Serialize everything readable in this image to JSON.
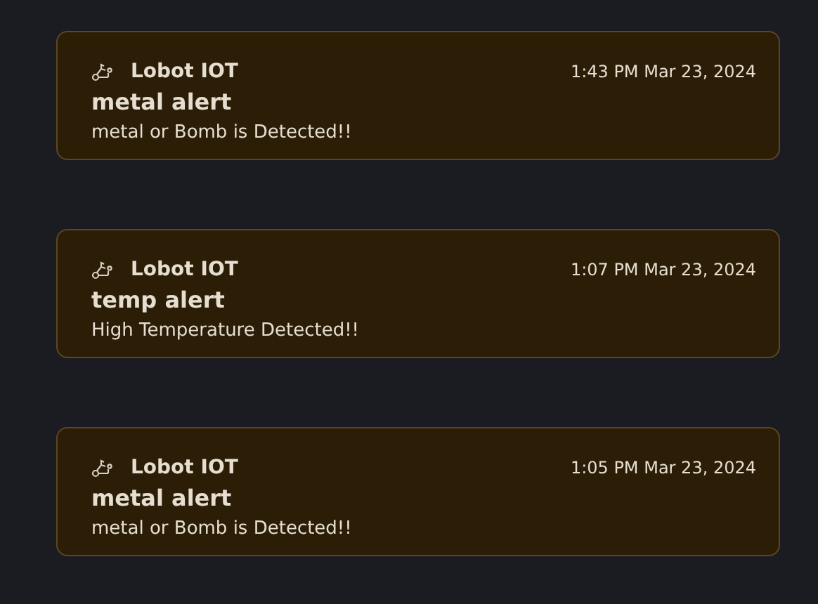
{
  "notifications": [
    {
      "app": "Lobot IOT",
      "time": "1:43 PM Mar 23, 2024",
      "title": "metal alert",
      "body": "metal or Bomb is Detected!!"
    },
    {
      "app": "Lobot IOT",
      "time": "1:07 PM Mar 23, 2024",
      "title": "temp alert",
      "body": "High Temperature Detected!!"
    },
    {
      "app": "Lobot IOT",
      "time": "1:05 PM Mar 23, 2024",
      "title": "metal alert",
      "body": "metal or Bomb is Detected!!"
    }
  ]
}
